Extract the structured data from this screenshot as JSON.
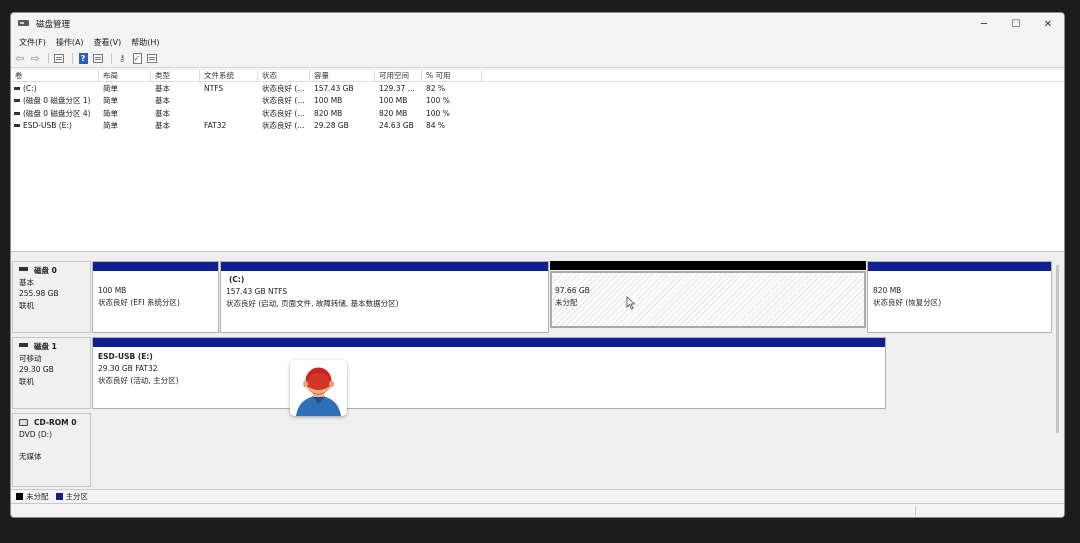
{
  "window": {
    "title": "磁盘管理",
    "minimize": "─",
    "maximize": "☐",
    "close": "✕"
  },
  "menu": [
    "文件(F)",
    "操作(A)",
    "查看(V)",
    "帮助(H)"
  ],
  "volumes": {
    "headers": [
      "卷",
      "布局",
      "类型",
      "文件系统",
      "状态",
      "容量",
      "可用空间",
      "% 可用"
    ],
    "rows": [
      [
        "(C:)",
        "简单",
        "基本",
        "NTFS",
        "状态良好 (...",
        "157.43 GB",
        "129.37 ...",
        "82 %"
      ],
      [
        "(磁盘 0 磁盘分区 1)",
        "简单",
        "基本",
        "",
        "状态良好 (...",
        "100 MB",
        "100 MB",
        "100 %"
      ],
      [
        "(磁盘 0 磁盘分区 4)",
        "简单",
        "基本",
        "",
        "状态良好 (...",
        "820 MB",
        "820 MB",
        "100 %"
      ],
      [
        "ESD-USB (E:)",
        "简单",
        "基本",
        "FAT32",
        "状态良好 (...",
        "29.28 GB",
        "24.63 GB",
        "84 %"
      ]
    ]
  },
  "disks": {
    "disk0": {
      "name": "磁盘 0",
      "type": "基本",
      "size": "255.98 GB",
      "state": "联机",
      "partitions": [
        {
          "title": "",
          "size": "100 MB",
          "status": "状态良好 (EFI 系统分区)"
        },
        {
          "title": "(C:)",
          "size": "157.43 GB NTFS",
          "status": "状态良好 (启动, 页面文件, 故障转储, 基本数据分区)"
        },
        {
          "title": "",
          "size": "97.66 GB",
          "status": "未分配"
        },
        {
          "title": "",
          "size": "820 MB",
          "status": "状态良好 (恢复分区)"
        }
      ]
    },
    "disk1": {
      "name": "磁盘 1",
      "type": "可移动",
      "size": "29.30 GB",
      "state": "联机",
      "partitions": [
        {
          "title": "ESD-USB  (E:)",
          "size": "29.30 GB FAT32",
          "status": "状态良好 (活动, 主分区)"
        }
      ]
    },
    "cdrom": {
      "name": "CD-ROM 0",
      "type": "DVD (D:)",
      "state": "无媒体"
    }
  },
  "legend": [
    "未分配",
    "主分区"
  ],
  "colors": {
    "primary_partition": "#0f1f8f",
    "unallocated": "#000000"
  },
  "icons": [
    "back-arrow-icon",
    "forward-arrow-icon",
    "help-icon",
    "disk-icon",
    "cdrom-icon"
  ]
}
